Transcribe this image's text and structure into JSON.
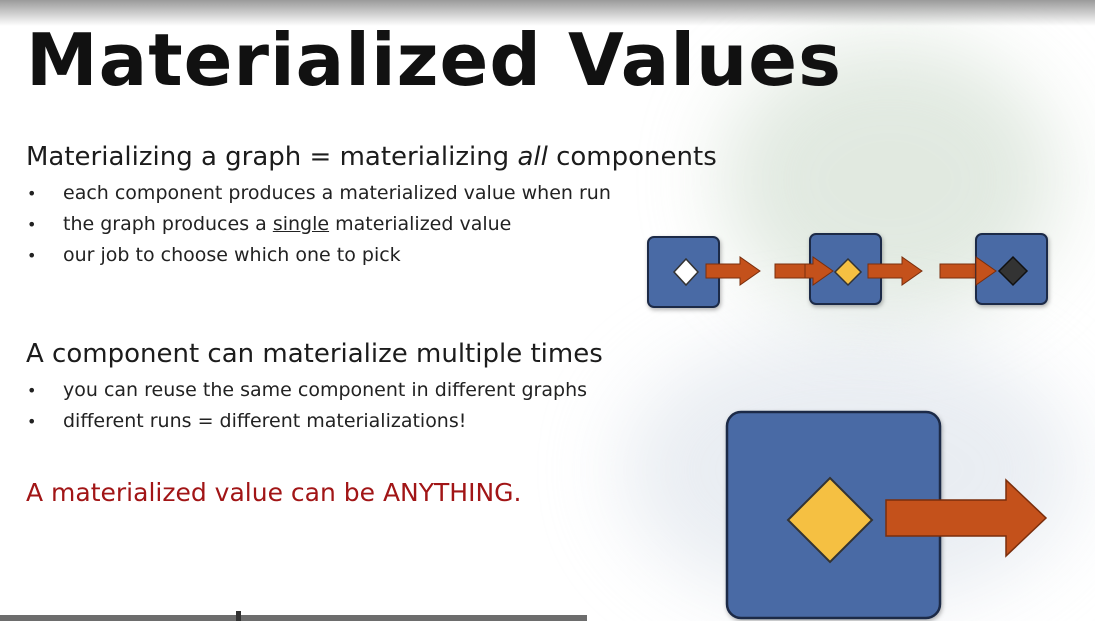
{
  "slide": {
    "title": "Materialized Values",
    "section1": {
      "heading_before": "Materializing a graph = materializing ",
      "heading_emphasis": "all",
      "heading_after": " components",
      "bullet_1": "each component produces a materialized value when run",
      "bullet_2_before": "the graph produces a ",
      "bullet_2_underlined": "single",
      "bullet_2_after": " materialized value",
      "bullet_3": "our job to choose which one to pick"
    },
    "section2": {
      "heading": "A component can materialize multiple times",
      "bullet_1": "you can reuse the same component in different graphs",
      "bullet_2": "different runs = different materializations!"
    },
    "callout": "A materialized value can be ANYTHING."
  },
  "colors": {
    "component_fill": "#4a6aa5",
    "arrow": "#c4511b",
    "diamond_white": "#ffffff",
    "diamond_yellow": "#f5c042",
    "diamond_dark": "#333333",
    "callout_red": "#a11516"
  },
  "icons": [
    "bullet-dot",
    "arrow-right",
    "diamond-marker"
  ]
}
